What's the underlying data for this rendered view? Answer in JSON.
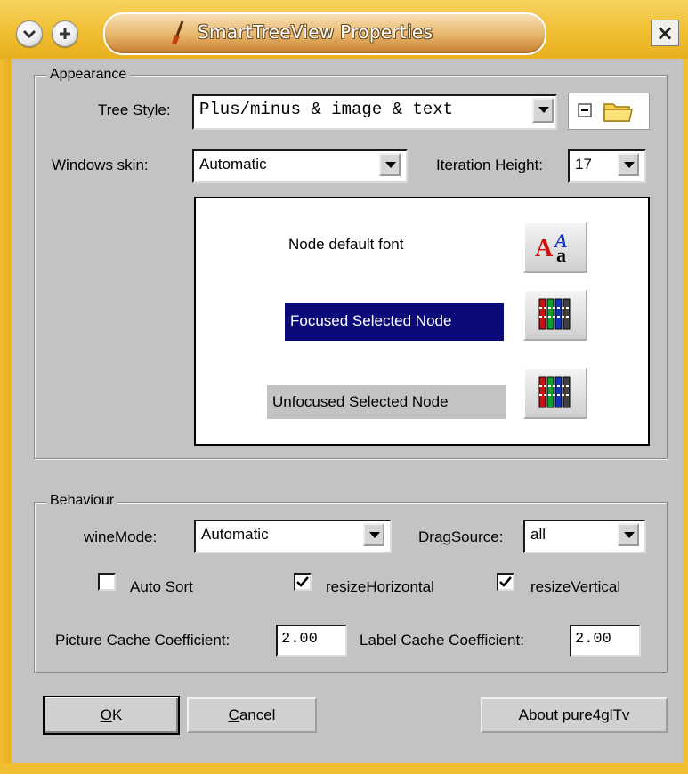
{
  "window": {
    "title": "SmartTreeView Properties",
    "close_label": "×",
    "colors": {
      "titlebar": "#f0be32",
      "client": "#c3c3c3",
      "selection": "#0a0a7a"
    }
  },
  "appearance": {
    "legend": "Appearance",
    "tree_style_label": "Tree Style:",
    "tree_style_value": "Plus/minus & image & text",
    "windows_skin_label": "Windows skin:",
    "windows_skin_value": "Automatic",
    "iteration_height_label": "Iteration Height:",
    "iteration_height_value": "17",
    "preview": {
      "default_font_label": "Node default font",
      "focused_label": "Focused Selected Node",
      "unfocused_label": "Unfocused Selected Node"
    }
  },
  "behaviour": {
    "legend": "Behaviour",
    "wine_mode_label": "wineMode:",
    "wine_mode_value": "Automatic",
    "drag_source_label": "DragSource:",
    "drag_source_value": "all",
    "auto_sort_label": "Auto Sort",
    "auto_sort_checked": false,
    "resize_horizontal_label": "resizeHorizontal",
    "resize_horizontal_checked": true,
    "resize_vertical_label": "resizeVertical",
    "resize_vertical_checked": true,
    "picture_cache_label": "Picture Cache Coefficient:",
    "picture_cache_value": "2.00",
    "label_cache_label": "Label Cache Coefficient:",
    "label_cache_value": "2.00"
  },
  "buttons": {
    "ok_underlined": "O",
    "ok_rest": "K",
    "cancel_underlined": "C",
    "cancel_rest": "ancel",
    "about": "About pure4glTv"
  },
  "icons": {
    "titlebar_menu": "chevron-down-icon",
    "titlebar_add": "plus-icon",
    "app": "brush-icon",
    "close": "close-icon",
    "tree_minus": "minus-box-icon",
    "tree_folder": "folder-icon",
    "font": "font-icon",
    "color": "color-bars-icon"
  }
}
